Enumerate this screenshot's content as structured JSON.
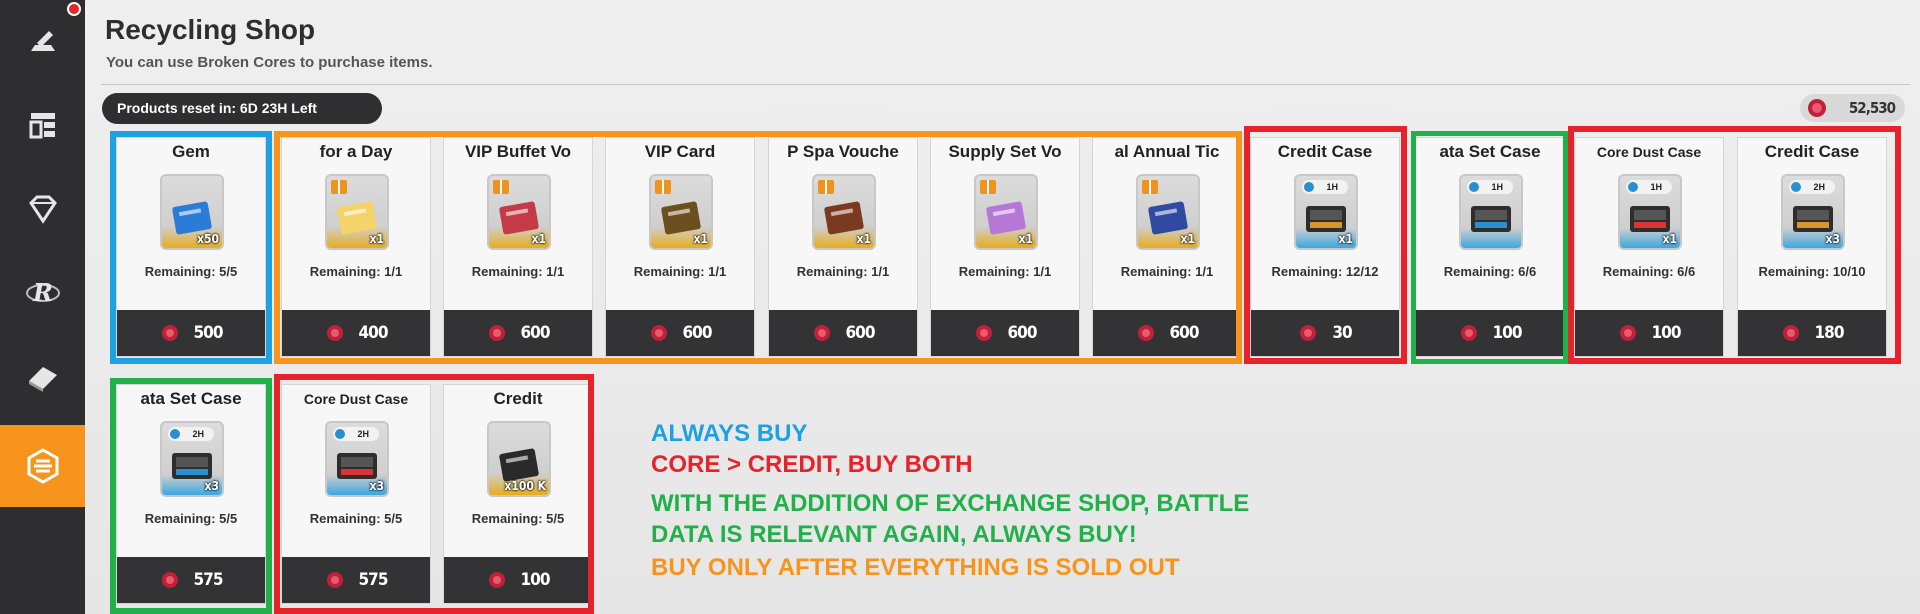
{
  "sidebar": {
    "items": [
      {
        "icon": "anvil-icon"
      },
      {
        "icon": "shop-icon"
      },
      {
        "icon": "diamond-icon"
      },
      {
        "icon": "r-logo-icon"
      },
      {
        "icon": "eraser-icon"
      },
      {
        "icon": "recycle-hex-icon",
        "active": true
      }
    ]
  },
  "header": {
    "title": "Recycling Shop",
    "subtitle": "You can use Broken Cores to purchase items."
  },
  "reset": {
    "label": "Products reset in: 6D 23H Left"
  },
  "currency": {
    "amount": "52,530",
    "icon": "broken-core-icon"
  },
  "products": [
    {
      "name": "Gem",
      "quantity": "x50",
      "remaining": "Remaining: 5/5",
      "price": "500"
    },
    {
      "name": "for a Day",
      "quantity": "x1",
      "remaining": "Remaining: 1/1",
      "price": "400"
    },
    {
      "name": "VIP Buffet Vo",
      "quantity": "x1",
      "remaining": "Remaining: 1/1",
      "price": "600"
    },
    {
      "name": "VIP Card",
      "quantity": "x1",
      "remaining": "Remaining: 1/1",
      "price": "600"
    },
    {
      "name": "P Spa Vouche",
      "quantity": "x1",
      "remaining": "Remaining: 1/1",
      "price": "600"
    },
    {
      "name": "Supply Set Vo",
      "quantity": "x1",
      "remaining": "Remaining: 1/1",
      "price": "600"
    },
    {
      "name": "al Annual Tic",
      "quantity": "x1",
      "remaining": "Remaining: 1/1",
      "price": "600"
    },
    {
      "name": "Credit Case",
      "duration": "1H",
      "quantity": "x1",
      "remaining": "Remaining: 12/12",
      "price": "30"
    },
    {
      "name": "ata Set Case",
      "duration": "1H",
      "quantity": "",
      "remaining": "Remaining: 6/6",
      "price": "100"
    },
    {
      "name": "Core Dust Case",
      "duration": "1H",
      "quantity": "x1",
      "remaining": "Remaining: 6/6",
      "price": "100"
    },
    {
      "name": "Credit Case",
      "duration": "2H",
      "quantity": "x3",
      "remaining": "Remaining: 10/10",
      "price": "180"
    },
    {
      "name": "ata Set Case",
      "duration": "2H",
      "quantity": "x3",
      "remaining": "Remaining: 5/5",
      "price": "575"
    },
    {
      "name": "Core Dust Case",
      "duration": "2H",
      "quantity": "x3",
      "remaining": "Remaining: 5/5",
      "price": "575"
    },
    {
      "name": "Credit",
      "quantity": "x100 K",
      "remaining": "Remaining: 5/5",
      "price": "100"
    }
  ],
  "notes": {
    "always_buy": "ALWAYS BUY",
    "core_credit": "CORE > CREDIT, BUY BOTH",
    "battle_line1": "WITH THE ADDITION OF EXCHANGE SHOP, BATTLE",
    "battle_line2": "DATA IS RELEVANT AGAIN, ALWAYS BUY!",
    "sold_out": "BUY ONLY AFTER EVERYTHING IS SOLD OUT"
  },
  "colors": {
    "blue": "#1ea1e0",
    "orange": "#f7941d",
    "red": "#e8222a",
    "green": "#22b04b",
    "sidebar": "#2e2e30",
    "active_tab": "#f7941d"
  }
}
